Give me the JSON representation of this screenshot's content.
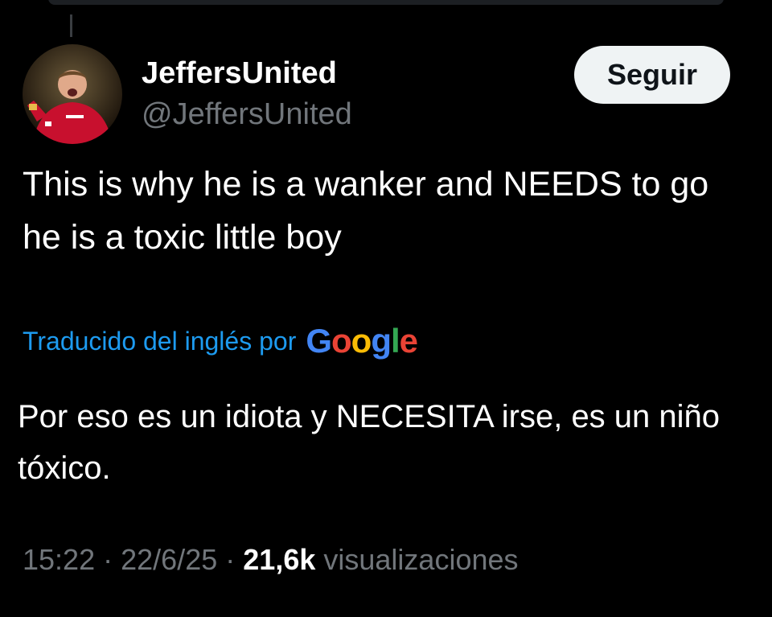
{
  "author": {
    "display_name": "JeffersUnited",
    "handle": "@JeffersUnited"
  },
  "follow_button": {
    "label": "Seguir"
  },
  "tweet": {
    "text": "This is why he is a wanker and NEEDS to go he is a toxic little boy"
  },
  "translation": {
    "translated_by_label": "Traducido del inglés por",
    "provider_name": "Google",
    "text": "Por eso es un idiota y NECESITA irse, es un niño tóxico."
  },
  "meta": {
    "time": "15:22",
    "separator": "·",
    "date": "22/6/25",
    "views_count": "21,6k",
    "views_label": "visualizaciones"
  },
  "colors": {
    "background": "#000000",
    "text_primary": "#ffffff",
    "text_secondary": "#71767b",
    "link_blue": "#1d9bf0",
    "follow_button_bg": "#eff3f4",
    "google_blue": "#4285F4",
    "google_red": "#EA4335",
    "google_yellow": "#FBBC05",
    "google_green": "#34A853"
  },
  "icons": {
    "avatar": "user-avatar-photo"
  }
}
